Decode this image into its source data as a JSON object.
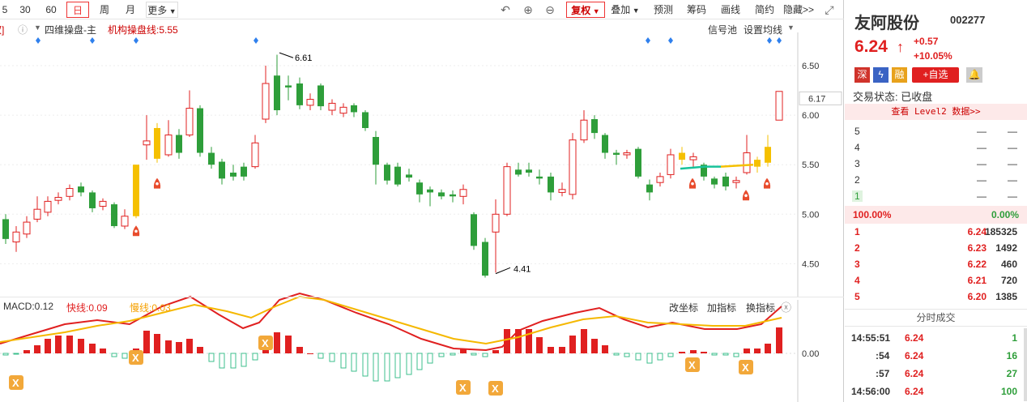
{
  "toolbar": {
    "tabs": [
      "5",
      "30",
      "60",
      "日",
      "周",
      "月",
      "更多"
    ],
    "active": "日",
    "right": [
      "复权",
      "叠加",
      "预测",
      "筹码",
      "画线",
      "简约",
      "隐藏>>"
    ]
  },
  "subbar": {
    "left_cut": "权]",
    "indicator": "四维操盘-主",
    "inst_line": "机构操盘线:5.55",
    "right": [
      "信号池",
      "设置均线"
    ]
  },
  "price_axis": [
    "6.50",
    "6.00",
    "5.50",
    "5.00",
    "4.50"
  ],
  "current_price_label": "6.17",
  "annotations": {
    "high": "6.61",
    "low": "4.41"
  },
  "macd": {
    "title": "MACD:0.12",
    "fast": "快线:0.09",
    "slow": "慢线:0.03",
    "buttons": [
      "改坐标",
      "加指标",
      "换指标"
    ],
    "zero": "0.00"
  },
  "stock": {
    "name": "友阿股份",
    "code": "002277",
    "price": "6.24",
    "change": "+0.57",
    "pct": "+10.05%"
  },
  "badges": [
    "深",
    "融",
    "+自选"
  ],
  "status": "交易状态: 已收盘",
  "level2": "查看 Level2 数据>>",
  "sells": [
    {
      "n": "5",
      "p": "—",
      "v": "—"
    },
    {
      "n": "4",
      "p": "—",
      "v": "—"
    },
    {
      "n": "3",
      "p": "—",
      "v": "—"
    },
    {
      "n": "2",
      "p": "—",
      "v": "—"
    },
    {
      "n": "1",
      "p": "—",
      "v": "—"
    }
  ],
  "ratio": {
    "left": "100.00%",
    "right": "0.00%"
  },
  "buys": [
    {
      "n": "1",
      "p": "6.24",
      "v": "185325"
    },
    {
      "n": "2",
      "p": "6.23",
      "v": "1492"
    },
    {
      "n": "3",
      "p": "6.22",
      "v": "460"
    },
    {
      "n": "4",
      "p": "6.21",
      "v": "720"
    },
    {
      "n": "5",
      "p": "6.20",
      "v": "1385"
    }
  ],
  "ticks_title": "分时成交",
  "ticks": [
    {
      "t": "14:55:51",
      "p": "6.24",
      "v": "1"
    },
    {
      "t": ":54",
      "p": "6.24",
      "v": "16"
    },
    {
      "t": ":57",
      "p": "6.24",
      "v": "27"
    },
    {
      "t": "14:56:00",
      "p": "6.24",
      "v": "100"
    }
  ],
  "colors": {
    "up": "#e02020",
    "down": "#2e9e3a",
    "yellow": "#f5c000",
    "teal": "#18c29a"
  }
}
